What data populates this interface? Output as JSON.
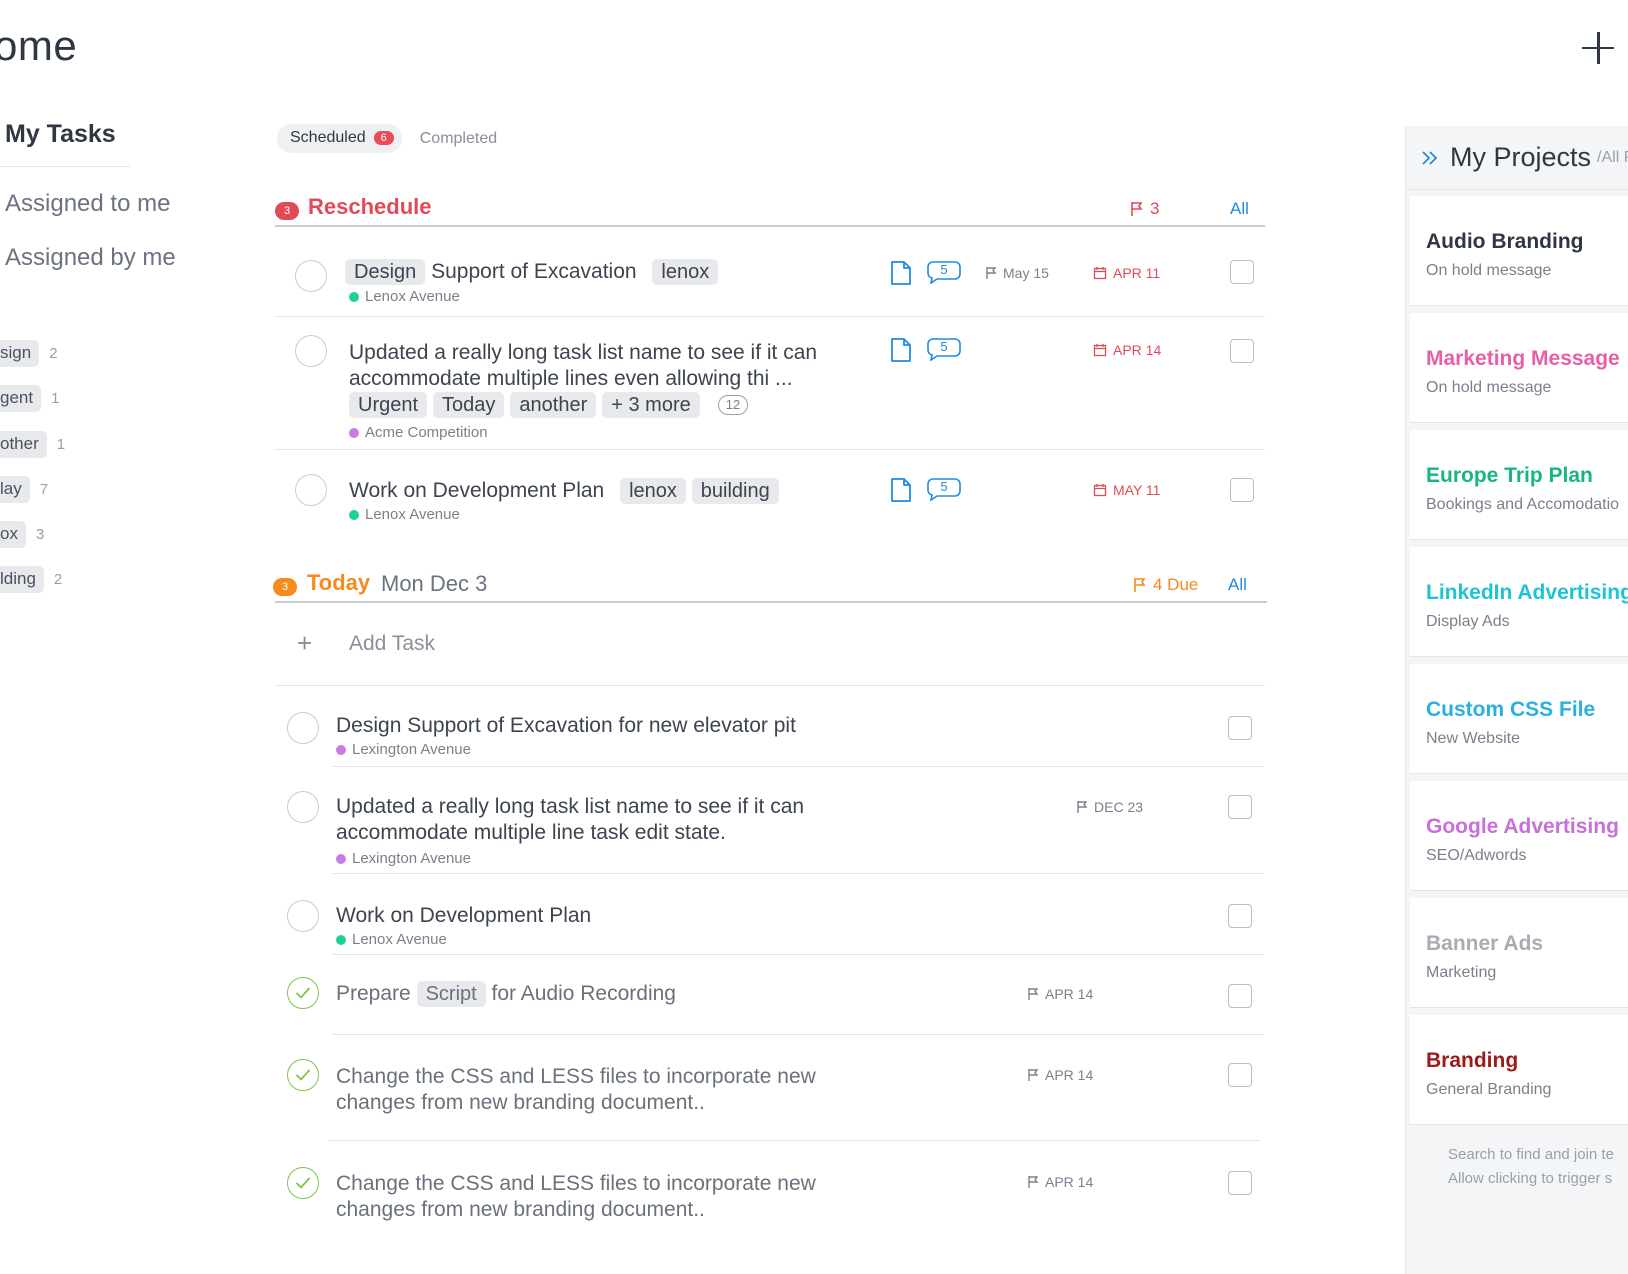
{
  "page": {
    "title": "ome"
  },
  "sidebar": {
    "heading": "My Tasks",
    "links": [
      "Assigned to me",
      "Assigned by me"
    ],
    "tags": [
      {
        "label": "sign",
        "count": "2"
      },
      {
        "label": "gent",
        "count": "1"
      },
      {
        "label": "other",
        "count": "1"
      },
      {
        "label": "lay",
        "count": "7"
      },
      {
        "label": "ox",
        "count": "3"
      },
      {
        "label": "lding",
        "count": "2"
      }
    ]
  },
  "tabs": {
    "scheduled": {
      "label": "Scheduled",
      "badge": "6"
    },
    "completed": {
      "label": "Completed"
    }
  },
  "reschedule": {
    "badge": "3",
    "title": "Reschedule",
    "flag_count": "3",
    "all_label": "All",
    "color": "#e24a58",
    "tasks": [
      {
        "tag_prefix": "Design",
        "title": "Support of Excavation",
        "tag_suffix": "lenox",
        "project": "Lenox Avenue",
        "project_color": "#1ed19b",
        "comments": "5",
        "flag_date": "May 15",
        "due": "APR 11"
      },
      {
        "line1": "Updated a really long task list name to see if it can",
        "line2": "accommodate multiple lines even allowing thi ...",
        "tags": [
          "Urgent",
          "Today",
          "another",
          "+ 3 more"
        ],
        "tag_comments": "12",
        "project": "Acme Competition",
        "project_color": "#c77de0",
        "comments": "5",
        "due": "APR 14"
      },
      {
        "title": "Work on Development Plan",
        "tags": [
          "lenox",
          "building"
        ],
        "project": "Lenox Avenue",
        "project_color": "#1ed19b",
        "comments": "5",
        "due": "MAY 11"
      }
    ]
  },
  "today": {
    "badge": "3",
    "title": "Today",
    "date": "Mon Dec 3",
    "due_label": "4 Due",
    "all_label": "All",
    "color": "#f58a1f",
    "add_task_label": "Add Task",
    "add_task_icon": "+",
    "tasks": [
      {
        "title": "Design Support of Excavation for new elevator pit",
        "project": "Lexington Avenue",
        "project_color": "#c77de0"
      },
      {
        "line1": "Updated a really long task list name to see if it can",
        "line2": "accommodate multiple line task edit state.",
        "project": "Lexington Avenue",
        "project_color": "#c77de0",
        "flag_date": "DEC 23"
      },
      {
        "title": "Work on Development Plan",
        "project": "Lenox Avenue",
        "project_color": "#1ed19b"
      },
      {
        "prefix": "Prepare",
        "tag": "Script",
        "suffix": "for Audio Recording",
        "flag_date": "APR 14",
        "completed": true
      },
      {
        "line1": "Change the CSS and LESS files to incorporate new",
        "line2": "changes from new branding document..",
        "flag_date": "APR 14",
        "completed": true
      },
      {
        "line1": "Change the CSS and LESS files to incorporate new",
        "line2": "changes from new branding document..",
        "flag_date": "APR 14",
        "completed": true
      }
    ]
  },
  "projects": {
    "title": "My Projects",
    "subtitle": "/All P",
    "items": [
      {
        "name": "Audio Branding",
        "desc": "On hold message",
        "color": "#2f3743"
      },
      {
        "name": "Marketing Message",
        "desc": "On hold message",
        "color": "#e85fa6"
      },
      {
        "name": "Europe Trip Plan",
        "desc": "Bookings and Accomodatio",
        "color": "#17b584"
      },
      {
        "name": "LinkedIn Advertising",
        "desc": "Display Ads",
        "color": "#1ec3d6"
      },
      {
        "name": "Custom CSS File",
        "desc": "New Website",
        "color": "#2ab0df"
      },
      {
        "name": "Google Advertising",
        "desc": "SEO/Adwords",
        "color": "#c96fd9"
      },
      {
        "name": "Banner Ads",
        "desc": "Marketing",
        "color": "#a8adb5"
      },
      {
        "name": "Branding",
        "desc": "General Branding",
        "color": "#9e1a1a"
      }
    ],
    "help_line1": "Search to find and join te",
    "help_line2": "Allow clicking to trigger s"
  },
  "icons": {
    "add": "plus-icon",
    "double_chevron": "double-chevron-right-icon",
    "document": "document-icon",
    "comment": "comment-bubble-icon",
    "flag": "flag-icon",
    "calendar": "calendar-icon",
    "check": "checkmark-icon"
  },
  "colors": {
    "accent_blue": "#1f8be0",
    "complete_green": "#7cc64a",
    "due_red": "#e24a58"
  }
}
